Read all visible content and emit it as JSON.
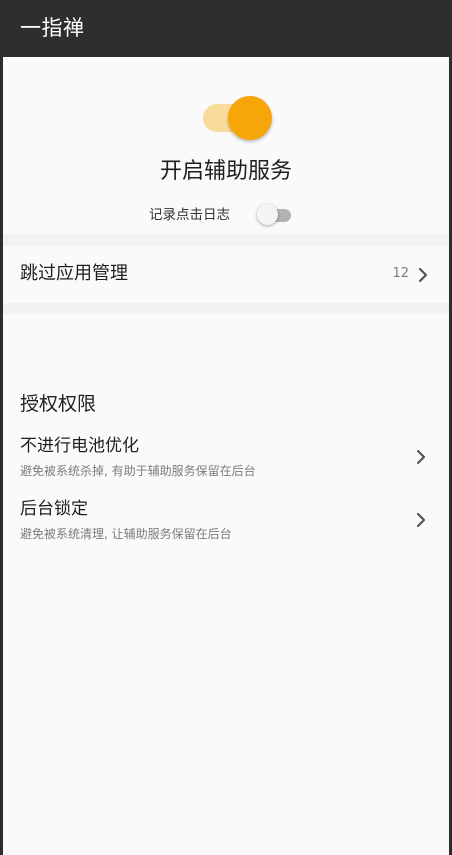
{
  "app": {
    "title": "一指禅"
  },
  "service": {
    "title": "开启辅助服务",
    "enabled": true,
    "accent_color": "#f6a609",
    "track_color": "#f8dc9c"
  },
  "log": {
    "label": "记录点击日志",
    "enabled": false
  },
  "skip": {
    "label": "跳过应用管理",
    "count": "12"
  },
  "permissions": {
    "section_title": "授权权限",
    "items": [
      {
        "title": "不进行电池优化",
        "subtitle": "避免被系统杀掉, 有助于辅助服务保留在后台"
      },
      {
        "title": "后台锁定",
        "subtitle": "避免被系统清理, 让辅助服务保留在后台"
      }
    ]
  },
  "icons": {
    "chevron": "chevron-right-icon"
  }
}
